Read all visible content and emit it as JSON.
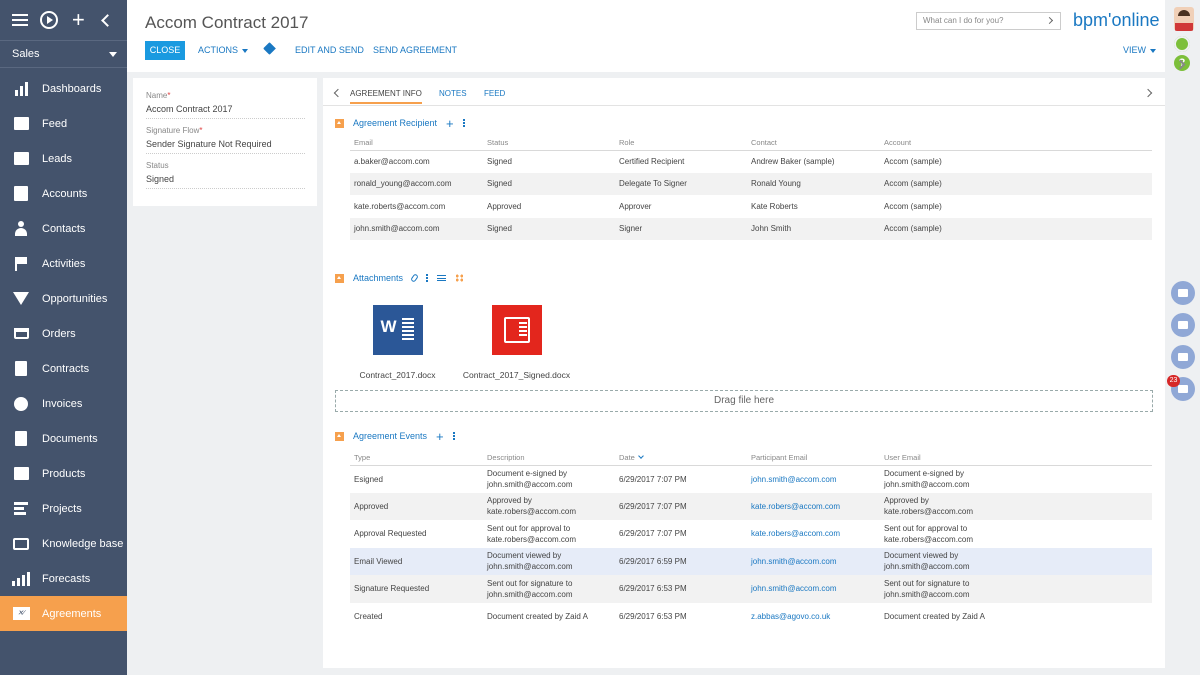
{
  "nav": {
    "section": "Sales",
    "items": [
      {
        "label": "Dashboards",
        "icon": "bar-chart-icon"
      },
      {
        "label": "Feed",
        "icon": "chat-icon"
      },
      {
        "label": "Leads",
        "icon": "leads-icon"
      },
      {
        "label": "Accounts",
        "icon": "building-icon"
      },
      {
        "label": "Contacts",
        "icon": "person-icon"
      },
      {
        "label": "Activities",
        "icon": "flag-icon"
      },
      {
        "label": "Opportunities",
        "icon": "funnel-icon"
      },
      {
        "label": "Orders",
        "icon": "cart-icon"
      },
      {
        "label": "Contracts",
        "icon": "contract-icon"
      },
      {
        "label": "Invoices",
        "icon": "coins-icon"
      },
      {
        "label": "Documents",
        "icon": "document-icon"
      },
      {
        "label": "Products",
        "icon": "box-icon"
      },
      {
        "label": "Projects",
        "icon": "projects-icon"
      },
      {
        "label": "Knowledge base",
        "icon": "book-icon"
      },
      {
        "label": "Forecasts",
        "icon": "trend-icon"
      },
      {
        "label": "Agreements",
        "icon": "agreement-icon",
        "active": true
      }
    ]
  },
  "header": {
    "title": "Accom Contract 2017",
    "close_label": "CLOSE",
    "actions_label": "ACTIONS",
    "edit_send_label": "EDIT AND SEND",
    "send_agreement_label": "SEND AGREEMENT",
    "view_label": "VIEW",
    "search_placeholder": "What can I do for you?",
    "logo": "bpm'online"
  },
  "notifications": {
    "count": "23"
  },
  "record": {
    "name_label": "Name",
    "name_value": "Accom Contract 2017",
    "flow_label": "Signature Flow",
    "flow_value": "Sender Signature Not Required",
    "status_label": "Status",
    "status_value": "Signed"
  },
  "tabs": [
    "AGREEMENT INFO",
    "NOTES",
    "FEED"
  ],
  "recipients": {
    "title": "Agreement Recipient",
    "columns": [
      "Email",
      "Status",
      "Role",
      "Contact",
      "Account"
    ],
    "rows": [
      [
        "a.baker@accom.com",
        "Signed",
        "Certified Recipient",
        "Andrew Baker (sample)",
        "Accom (sample)"
      ],
      [
        "ronald_young@accom.com",
        "Signed",
        "Delegate To Signer",
        "Ronald Young",
        "Accom (sample)"
      ],
      [
        "kate.roberts@accom.com",
        "Approved",
        "Approver",
        "Kate Roberts",
        "Accom (sample)"
      ],
      [
        "john.smith@accom.com",
        "Signed",
        "Signer",
        "John Smith",
        "Accom (sample)"
      ]
    ]
  },
  "attachments": {
    "title": "Attachments",
    "files": [
      {
        "name": "Contract_2017.docx",
        "icon": "word-file-icon"
      },
      {
        "name": "Contract_2017_Signed.docx",
        "icon": "pdf-file-icon"
      }
    ],
    "drop_text": "Drag file here"
  },
  "events": {
    "title": "Agreement Events",
    "columns": [
      "Type",
      "Description",
      "Date",
      "Participant Email",
      "User Email"
    ],
    "rows": [
      {
        "type": "Esigned",
        "desc1": "Document e-signed by",
        "desc2": "john.smith@accom.com",
        "date": "6/29/2017 7:07 PM",
        "email": "john.smith@accom.com",
        "user1": "Document e-signed by",
        "user2": "john.smith@accom.com"
      },
      {
        "type": "Approved",
        "desc1": "Approved by",
        "desc2": "kate.robers@accom.com",
        "date": "6/29/2017 7:07 PM",
        "email": "kate.robers@accom.com",
        "user1": "Approved by",
        "user2": "kate.robers@accom.com"
      },
      {
        "type": "Approval Requested",
        "desc1": "Sent out for approval to",
        "desc2": "kate.robers@accom.com",
        "date": "6/29/2017 7:07 PM",
        "email": "kate.robers@accom.com",
        "user1": "Sent out for approval to",
        "user2": "kate.robers@accom.com"
      },
      {
        "type": "Email Viewed",
        "desc1": "Document viewed by",
        "desc2": "john.smith@accom.com",
        "date": "6/29/2017 6:59 PM",
        "email": "john.smith@accom.com",
        "user1": "Document viewed by",
        "user2": "john.smith@accom.com"
      },
      {
        "type": "Signature Requested",
        "desc1": "Sent out for signature to",
        "desc2": "john.smith@accom.com",
        "date": "6/29/2017 6:53 PM",
        "email": "john.smith@accom.com",
        "user1": "Sent out for signature to",
        "user2": "john.smith@accom.com"
      },
      {
        "type": "Created",
        "desc1": "Document created by Zaid A",
        "desc2": "",
        "date": "6/29/2017 6:53 PM",
        "email": "z.abbas@agovo.co.uk",
        "user1": "Document created by Zaid A",
        "user2": ""
      }
    ]
  },
  "colors": {
    "nav_bg": "#44536c",
    "accent": "#f6a04d",
    "link": "#1a78c2",
    "primary_button": "#1a9ae0"
  }
}
